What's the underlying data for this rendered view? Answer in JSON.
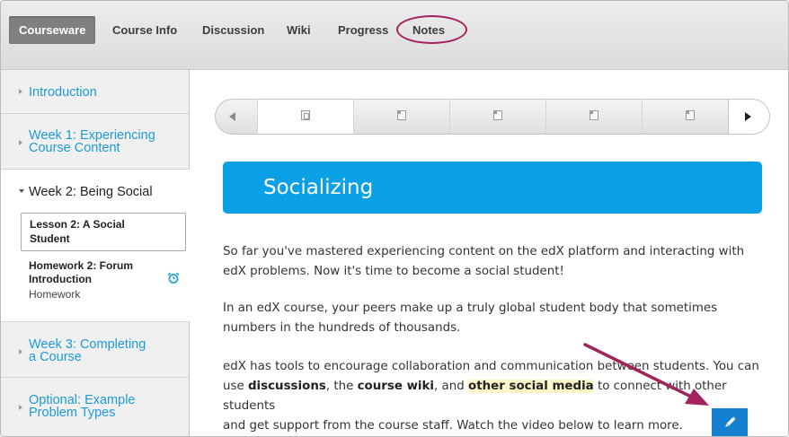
{
  "topnav": {
    "tabs": [
      {
        "label": "Courseware",
        "active": true
      },
      {
        "label": "Course Info"
      },
      {
        "label": "Discussion"
      },
      {
        "label": "Wiki"
      },
      {
        "label": "Progress"
      },
      {
        "label": "Notes",
        "highlighted": true
      }
    ]
  },
  "sidebar": {
    "chapters": [
      {
        "title": "Introduction"
      },
      {
        "title_line1": "Week 1: Experiencing",
        "title_line2": "Course Content"
      },
      {
        "title": "Week 2: Being Social",
        "open": true
      },
      {
        "title_line1": "Week 3: Completing",
        "title_line2": "a Course"
      },
      {
        "title_line1": "Optional: Example",
        "title_line2": "Problem Types"
      }
    ],
    "lesson": {
      "line1": "Lesson 2: A Social",
      "line2": "Student"
    },
    "homework": {
      "line1": "Homework 2: Forum",
      "line2": "Introduction",
      "type": "Homework",
      "icon": "alarm-clock-icon"
    }
  },
  "sequence": {
    "items": [
      "video",
      "document",
      "document",
      "document",
      "document"
    ],
    "active_index": 0
  },
  "content": {
    "heading": "Socializing",
    "p1_line1": "So far you've mastered experiencing content on the edX platform and interacting with",
    "p1_line2": "edX problems. Now it's time to become a social student!",
    "p2_line1": "In an edX course, your peers make up a truly global student body that sometimes",
    "p2_line2": "numbers in the hundreds of thousands.",
    "p3_line1": "edX has tools to encourage collaboration and communication between students. You can",
    "p3_l2_a": "use ",
    "p3_l2_b": "discussions",
    "p3_l2_c": ", the ",
    "p3_l2_d": "course wiki",
    "p3_l2_e": ", and ",
    "p3_l2_f": "other social media",
    "p3_l2_g": " to connect with other students",
    "p3_line3": "and get support from the course staff. Watch the video below to learn more."
  },
  "colors": {
    "accent": "#0aa0e6",
    "link": "#1d9ad6",
    "annotation": "#a3235e",
    "edit_button": "#1580d0"
  },
  "icons": {
    "edit": "pencil-icon",
    "prev": "chevron-left-icon",
    "next": "chevron-right-icon"
  }
}
